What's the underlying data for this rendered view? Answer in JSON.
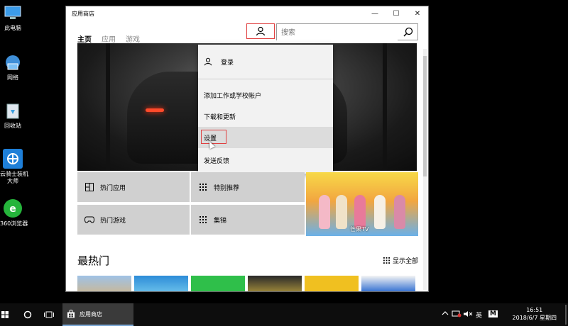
{
  "desktop": {
    "icons": [
      {
        "label": "此电脑",
        "icon": "computer-icon"
      },
      {
        "label": "网络",
        "icon": "network-icon"
      },
      {
        "label": "回收站",
        "icon": "recycle-bin-icon"
      },
      {
        "label_line1": "云骑士装机",
        "label_line2": "大师",
        "icon": "yunqishi-icon"
      },
      {
        "label": "360浏览器",
        "icon": "360-browser-icon"
      }
    ]
  },
  "window": {
    "title": "应用商店",
    "controls": {
      "minimize": "—",
      "maximize": "☐",
      "close": "✕"
    }
  },
  "nav": {
    "tabs": [
      {
        "label": "主页",
        "active": true
      },
      {
        "label": "应用",
        "active": false
      },
      {
        "label": "游戏",
        "active": false
      }
    ]
  },
  "search": {
    "placeholder": "搜索",
    "value": ""
  },
  "account_menu": {
    "items": [
      {
        "label": "登录",
        "icon": "user-icon"
      },
      {
        "label": "添加工作或学校帐户"
      },
      {
        "label": "下载和更新"
      },
      {
        "label": "设置"
      },
      {
        "label": "发送反馈"
      }
    ]
  },
  "tiles": [
    {
      "label": "热门应用",
      "icon": "apps-grid-icon"
    },
    {
      "label": "特别推荐",
      "icon": "dots-grid-icon"
    },
    {
      "label": "热门游戏",
      "icon": "gamepad-icon"
    },
    {
      "label": "集锦",
      "icon": "dots-grid-icon"
    }
  ],
  "promo": {
    "label": "芒果TV"
  },
  "section": {
    "title": "最热门",
    "show_all": "显示全部"
  },
  "taskbar": {
    "app_label": "应用商店",
    "input_method": "英",
    "ime_mode": "M",
    "time": "16:51",
    "date": "2018/6/7 星期四"
  },
  "colors": {
    "highlight_box": "#e04040",
    "tile_bg": "#d0d0d0",
    "menu_bg": "#f2f2f2",
    "taskbar_bg": "#0d0d0d"
  }
}
